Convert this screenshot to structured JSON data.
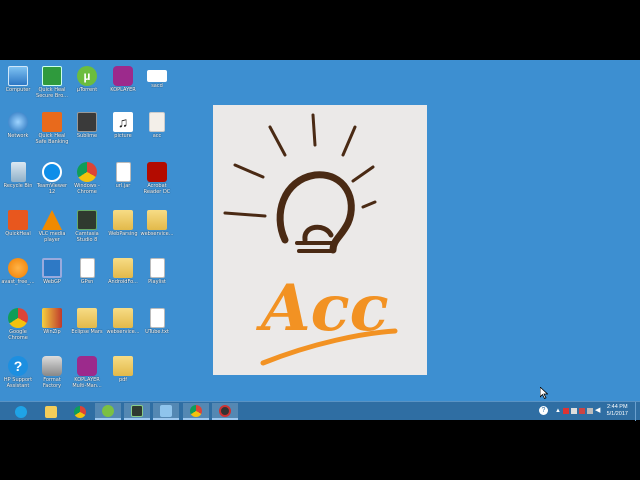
{
  "desktop": {
    "icons": [
      {
        "label": "Computer",
        "icon": "computer-icon"
      },
      {
        "label": "Quick Heal Secure Bro...",
        "icon": "quick-heal-browser-icon"
      },
      {
        "label": "µTorrent",
        "icon": "utorrent-icon"
      },
      {
        "label": "KOPLAYER",
        "icon": "koplayer-icon"
      },
      {
        "label": "sacd",
        "icon": "blank-file-icon"
      },
      {
        "label": "Network",
        "icon": "network-icon"
      },
      {
        "label": "Quick Heal Safe Banking",
        "icon": "quick-heal-banking-icon"
      },
      {
        "label": "Sublime",
        "icon": "sublime-icon"
      },
      {
        "label": "picture",
        "icon": "music-note-icon"
      },
      {
        "label": "acc",
        "icon": "image-file-icon"
      },
      {
        "label": "Recycle Bin",
        "icon": "recycle-bin-icon"
      },
      {
        "label": "TeamViewer 12",
        "icon": "teamviewer-icon"
      },
      {
        "label": "Windows - Chrome",
        "icon": "chrome-icon"
      },
      {
        "label": "url.jar",
        "icon": "document-icon"
      },
      {
        "label": "Acrobat Reader DC",
        "icon": "acrobat-icon"
      },
      {
        "label": "QuickHeal",
        "icon": "quickheal-icon"
      },
      {
        "label": "VLC media player",
        "icon": "vlc-icon"
      },
      {
        "label": "Camtasia Studio 8",
        "icon": "camtasia-icon"
      },
      {
        "label": "WebParsing",
        "icon": "folder-icon"
      },
      {
        "label": "webservice...",
        "icon": "folder-icon"
      },
      {
        "label": "avast_free_...",
        "icon": "avast-icon"
      },
      {
        "label": "WebGP",
        "icon": "webgp-icon"
      },
      {
        "label": "GPsn",
        "icon": "document-icon"
      },
      {
        "label": "AndroidFo...",
        "icon": "folder-icon"
      },
      {
        "label": "Playlist",
        "icon": "document-icon"
      },
      {
        "label": "Google Chrome",
        "icon": "chrome-icon"
      },
      {
        "label": "WinZip",
        "icon": "winzip-icon"
      },
      {
        "label": "Eclipse Mars",
        "icon": "folder-icon"
      },
      {
        "label": "webservice...",
        "icon": "folder-icon"
      },
      {
        "label": "UTube.txt",
        "icon": "document-icon"
      },
      {
        "label": "HP Support Assistant",
        "icon": "help-icon"
      },
      {
        "label": "Format Factory",
        "icon": "format-factory-icon"
      },
      {
        "label": "KOPLAYER Multi-Man...",
        "icon": "koplayer-icon"
      },
      {
        "label": "pdf",
        "icon": "folder-icon"
      }
    ],
    "preview": {
      "logo_text": "Acc"
    }
  },
  "taskbar": {
    "buttons": [
      {
        "name": "internet-explorer",
        "icon": "ie-icon"
      },
      {
        "name": "file-explorer",
        "icon": "folder-icon"
      },
      {
        "name": "chrome",
        "icon": "chrome-icon"
      },
      {
        "name": "android-studio",
        "icon": "android-icon"
      },
      {
        "name": "camtasia",
        "icon": "camtasia-icon"
      },
      {
        "name": "photos",
        "icon": "photos-icon"
      },
      {
        "name": "chrome-2",
        "icon": "chrome-icon"
      },
      {
        "name": "recorder",
        "icon": "recorder-icon"
      }
    ],
    "clock": {
      "time": "2:44 PM",
      "date": "5/1/2017"
    }
  }
}
